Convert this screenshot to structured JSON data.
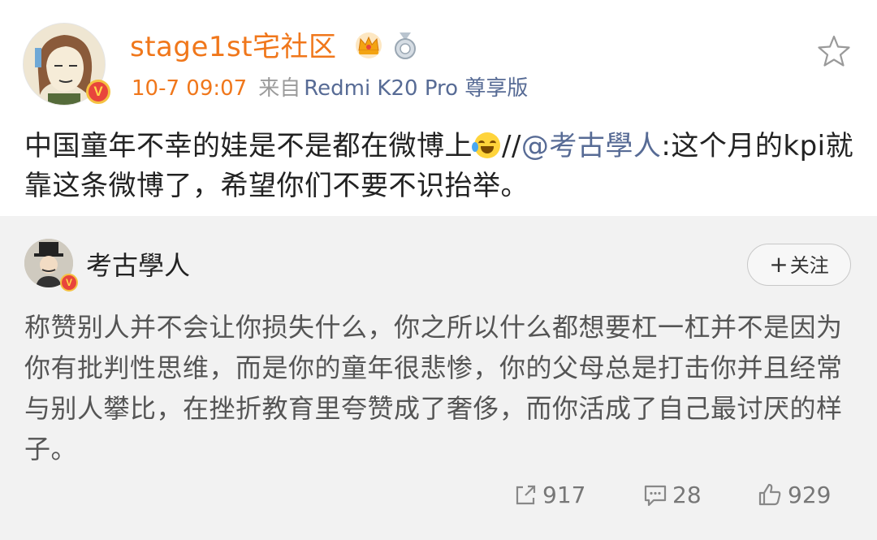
{
  "post": {
    "username": "stage1st宅社区",
    "time": "10-7 09:07",
    "source_prefix": "来自",
    "device": "Redmi K20 Pro 尊享版",
    "text_before_emoji": "中国童年不幸的娃是不是都在微博上",
    "repost_sep": "//",
    "mention": "@考古學人",
    "text_after_mention": ":这个月的kpi就靠这条微博了，希望你们不要不识抬举。",
    "verified_badge": "V"
  },
  "repost": {
    "username": "考古學人",
    "follow_label": "关注",
    "follow_plus": "+",
    "text": "称赞别人并不会让你损失什么，你之所以什么都想要杠一杠并不是因为你有批判性思维，而是你的童年很悲惨，你的父母总是打击你并且经常与别人攀比，在挫折教育里夸赞成了奢侈，而你活成了自己最讨厌的样子。",
    "verified_badge": "V",
    "stats": {
      "reposts": "917",
      "comments": "28",
      "likes": "929"
    }
  },
  "icons": {
    "star": "star-outline-icon",
    "crown": "crown-badge-icon",
    "medal": "medal-badge-icon",
    "emoji": "laugh-cry-emoji",
    "repost": "share-icon",
    "comment": "comment-icon",
    "like": "thumbs-up-icon"
  },
  "colors": {
    "username": "#f0771b",
    "link": "#576b95",
    "repost_bg": "#f2f2f2"
  }
}
